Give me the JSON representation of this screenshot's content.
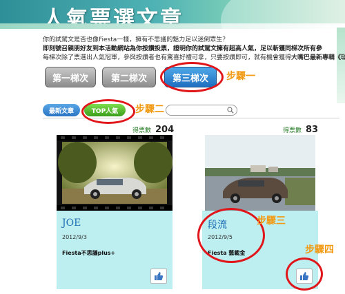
{
  "header": {
    "title": "人氣票選文章"
  },
  "intro": {
    "line1": "你的試駕文是否也像Fiesta一樣，擁有不思議的魅力足以迷倒眾生？",
    "line2": "即刻號召親朋好友到本活動網站為你按讚投票，證明你的試駕文擁有超高人氣，足以斬獲同梯次所有參",
    "line3_start": "每梯次除了票選出人氣冠軍，參與按讚者也有驚喜好禮可拿，只要按讚即可，就有機會獲得",
    "line3_bold": "大嘴巴最新專輯《琺"
  },
  "tabs": [
    {
      "label": "第一梯次"
    },
    {
      "label": "第二梯次"
    },
    {
      "label": "第三梯次"
    }
  ],
  "filters": {
    "latest": "最新文章",
    "top": "TOP人氣"
  },
  "search": {
    "placeholder": ""
  },
  "steps": {
    "s1": "步驟一",
    "s2": "步驟二",
    "s3": "步驟三",
    "s4": "步驟四"
  },
  "vote_label": "得票數",
  "cards": [
    {
      "name": "JOE",
      "date": "2012/9/3",
      "desc": "Fiesta不思議plus+",
      "votes": "204"
    },
    {
      "name": "段流",
      "date": "2012/9/5",
      "desc": "Fiesta 藝載金",
      "votes": "83"
    }
  ],
  "colors": {
    "accent": "#e0161b",
    "step": "#f29a12",
    "card_bg": "#bdeef0"
  }
}
